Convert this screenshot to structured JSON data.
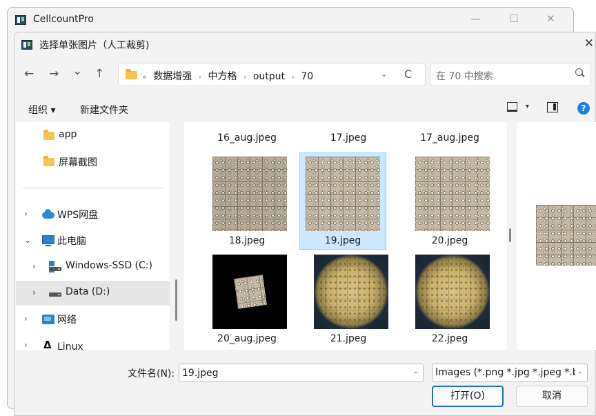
{
  "parent_window": {
    "title": "CellcountPro",
    "minimize": "—",
    "maximize": "☐",
    "close": "✕"
  },
  "dialog": {
    "title": "选择单张图片（人工裁剪)",
    "close": "✕"
  },
  "nav": {
    "back": "←",
    "forward": "→",
    "recent": "⌄",
    "up": "↑"
  },
  "address": {
    "overflow": "«",
    "separator": "›",
    "crumbs": [
      "数据增强",
      "中方格",
      "output",
      "70"
    ],
    "dropdown": "⌄",
    "refresh": "C"
  },
  "search": {
    "placeholder": "在 70 中搜索"
  },
  "toolbar": {
    "organize": "组织 ▾",
    "new_folder": "新建文件夹",
    "view_dropdown": "▾",
    "help": "?"
  },
  "sidebar": {
    "items": [
      {
        "label": "app",
        "icon": "folder-icon"
      },
      {
        "label": "屏幕截图",
        "icon": "folder-icon"
      },
      {
        "label": "WPS网盘",
        "icon": "cloud-icon",
        "expand": "›"
      },
      {
        "label": "此电脑",
        "icon": "computer-icon",
        "expand": "⌄"
      },
      {
        "label": "Windows-SSD (C:)",
        "icon": "windows-drive-icon",
        "expand": "›"
      },
      {
        "label": "Data (D:)",
        "icon": "drive-icon",
        "expand": "›",
        "selected": true
      },
      {
        "label": "网络",
        "icon": "network-icon",
        "expand": "›"
      },
      {
        "label": "Linux",
        "icon": "linux-icon",
        "expand": "›"
      }
    ]
  },
  "files": [
    {
      "name": "16_aug.jpeg",
      "thumb": "black"
    },
    {
      "name": "17.jpeg",
      "thumb": "cells"
    },
    {
      "name": "17_aug.jpeg",
      "thumb": "black"
    },
    {
      "name": "18.jpeg",
      "thumb": "cells"
    },
    {
      "name": "19.jpeg",
      "thumb": "cells",
      "selected": true
    },
    {
      "name": "20.jpeg",
      "thumb": "cells"
    },
    {
      "name": "20_aug.jpeg",
      "thumb": "black-rotated"
    },
    {
      "name": "21.jpeg",
      "thumb": "microscope"
    },
    {
      "name": "22.jpeg",
      "thumb": "microscope"
    }
  ],
  "footer": {
    "filename_label": "文件名(N):",
    "filename_value": "19.jpeg",
    "filename_dropdown": "⌄",
    "filter": "Images (*.png *.jpg *.jpeg *.b",
    "filter_dropdown": "⌄",
    "open_button": "打开(O)",
    "cancel_button": "取消"
  },
  "colors": {
    "accent": "#1a6fc0",
    "selection": "#cce8ff",
    "help": "#1e7fe0",
    "folder": "#f5c451"
  }
}
